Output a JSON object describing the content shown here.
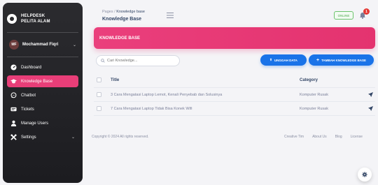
{
  "sidebar": {
    "brand": {
      "line1": "HELPDESK",
      "line2": "PELITA ALAM"
    },
    "user": {
      "initials": "MF",
      "name": "Mochammad Fiqri"
    },
    "items": [
      {
        "label": "Dashboard",
        "icon": "dashboard-icon"
      },
      {
        "label": "Knowledge Base",
        "icon": "graduation-cap-icon",
        "active": true
      },
      {
        "label": "Chatbot",
        "icon": "chat-icon"
      },
      {
        "label": "Tickets",
        "icon": "ticket-icon"
      },
      {
        "label": "Manage Users",
        "icon": "user-icon"
      },
      {
        "label": "Settings",
        "icon": "tools-icon"
      }
    ]
  },
  "topbar": {
    "breadcrumb_root": "Pages",
    "breadcrumb_sep": "/",
    "breadcrumb_current": "Knowledge base",
    "title": "Knowledge Base",
    "status": "ONLINE",
    "notification_count": "1"
  },
  "header": {
    "title": "KNOWLEDGE BASE",
    "accent": "#e83e78"
  },
  "toolbar": {
    "search_placeholder": "Cari Knowledge...",
    "upload_label": "UNGGAH DATA",
    "add_label": "TAMBAH KNOWLEDGE BASE",
    "button_color": "#1a73e8"
  },
  "table": {
    "columns": {
      "title": "Title",
      "category": "Category"
    },
    "rows": [
      {
        "title": "3 Cara Mengatasi Laptop Lemot, Kenali Penyebab dan Solusinya",
        "category": "Komputer Rusak"
      },
      {
        "title": "7 Cara Mengatasi Laptop Tidak Bisa Konek Wifi",
        "category": "Komputer Rusak"
      }
    ]
  },
  "footer": {
    "copyright": "Copyright © 2024 All rights reserved.",
    "links": [
      "Creative Tim",
      "About Us",
      "Blog",
      "License"
    ]
  }
}
